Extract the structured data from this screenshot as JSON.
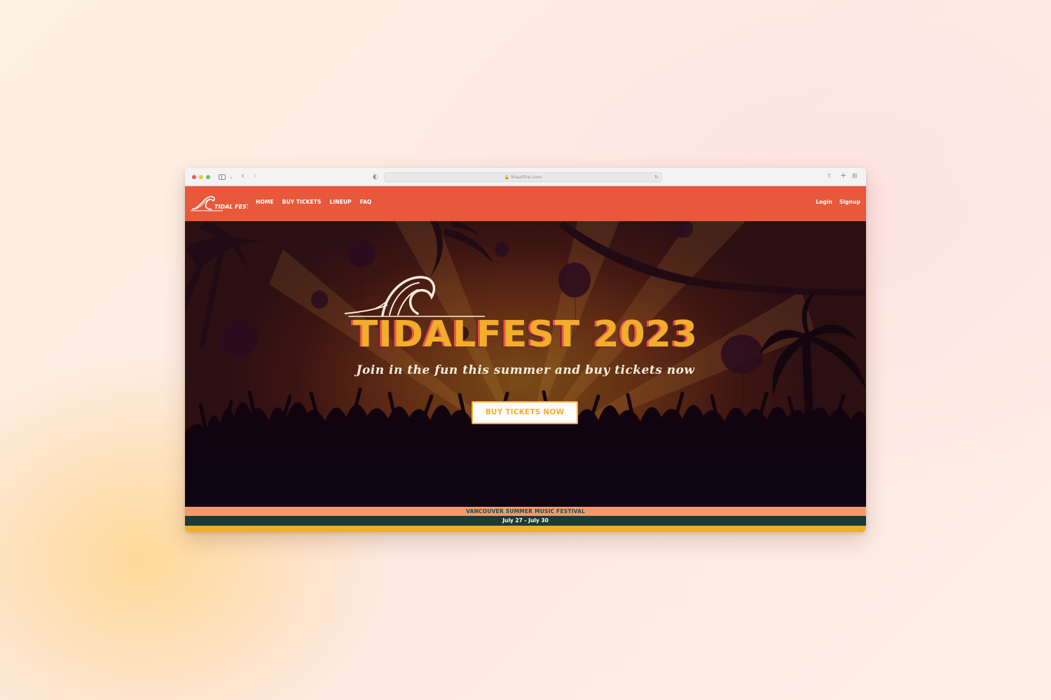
{
  "browser": {
    "url": "khazifire.com"
  },
  "nav": {
    "logo_text": "TIDAL FEST",
    "links": [
      {
        "label": "HOME"
      },
      {
        "label": "BUY TICKETS"
      },
      {
        "label": "LINEUP"
      },
      {
        "label": "FAQ"
      }
    ],
    "login": "Login",
    "signup": "Signup"
  },
  "hero": {
    "title": "TIDALFEST 2023",
    "subtitle": "Join in the fun this summer and buy tickets now",
    "cta": "BUY TICKETS NOW"
  },
  "footer_bands": {
    "tagline": "VANCOUVER SUMMER MUSIC FESTIVAL",
    "dates": "July 27 - July 30"
  },
  "colors": {
    "nav_bg": "#e8583a",
    "accent_yellow": "#f2ad2b",
    "band_peach": "#f39a6a",
    "band_dark": "#1b3a3a"
  }
}
